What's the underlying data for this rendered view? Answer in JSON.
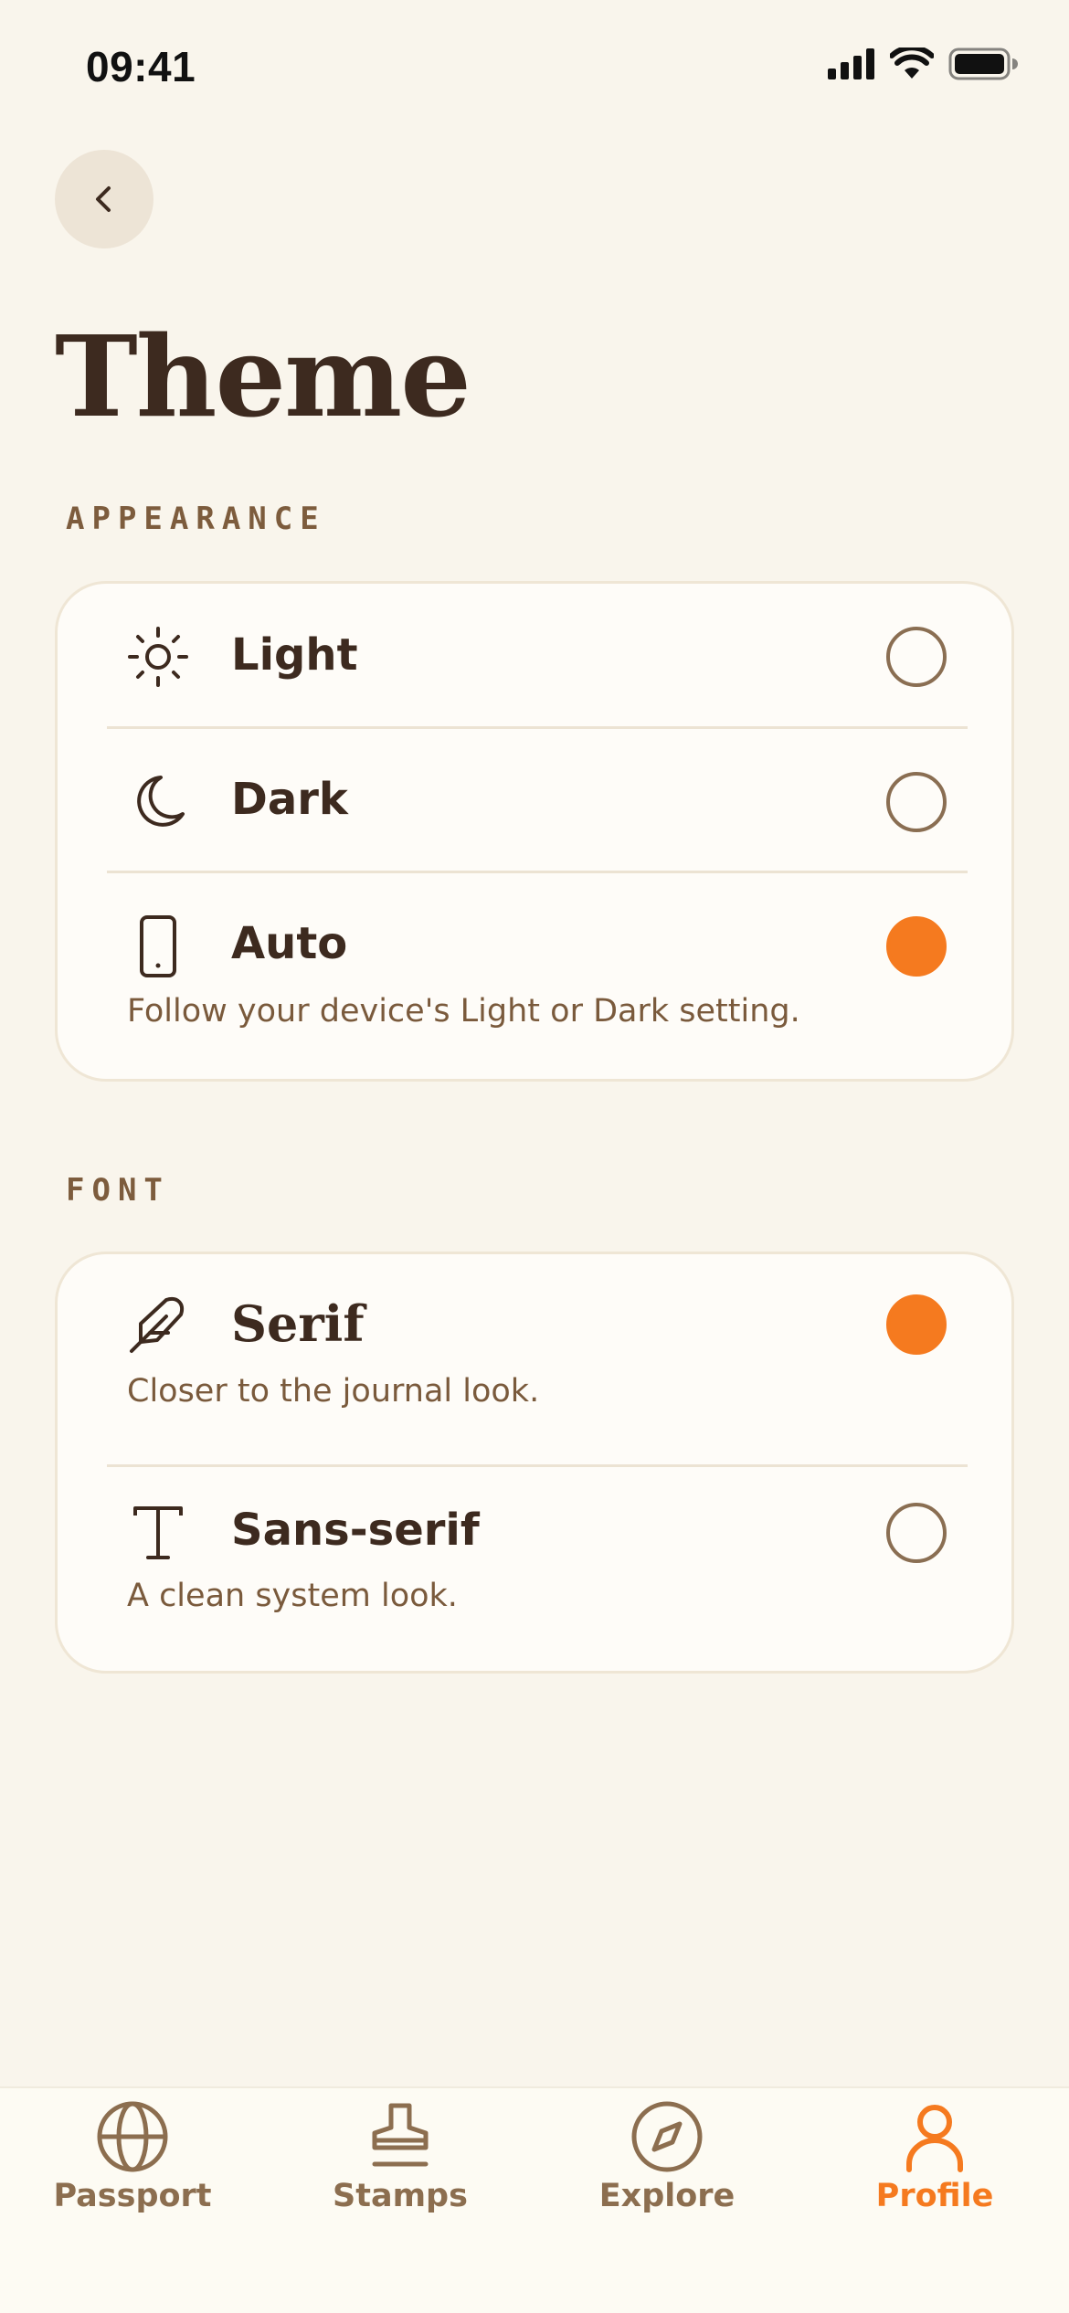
{
  "status_bar": {
    "time": "09:41"
  },
  "header": {
    "title": "Theme"
  },
  "appearance": {
    "section_label": "APPEARANCE",
    "options": [
      {
        "label": "Light",
        "icon": "sun-icon",
        "selected": false
      },
      {
        "label": "Dark",
        "icon": "moon-icon",
        "selected": false
      },
      {
        "label": "Auto",
        "icon": "phone-icon",
        "selected": true,
        "description": "Follow your device's Light or Dark setting."
      }
    ]
  },
  "font": {
    "section_label": "FONT",
    "options": [
      {
        "label": "Serif",
        "icon": "feather-icon",
        "selected": true,
        "description": "Closer to the journal look."
      },
      {
        "label": "Sans-serif",
        "icon": "text-t-icon",
        "selected": false,
        "description": "A clean system look."
      }
    ]
  },
  "tab_bar": {
    "tabs": [
      {
        "label": "Passport",
        "icon": "globe-icon",
        "active": false
      },
      {
        "label": "Stamps",
        "icon": "stamp-icon",
        "active": false
      },
      {
        "label": "Explore",
        "icon": "compass-icon",
        "active": false
      },
      {
        "label": "Profile",
        "icon": "person-icon",
        "active": true
      }
    ]
  },
  "colors": {
    "accent": "#f57a1f",
    "background": "#f9f5ec",
    "text_primary": "#3d2a1f",
    "text_secondary": "#7a5a3c"
  }
}
